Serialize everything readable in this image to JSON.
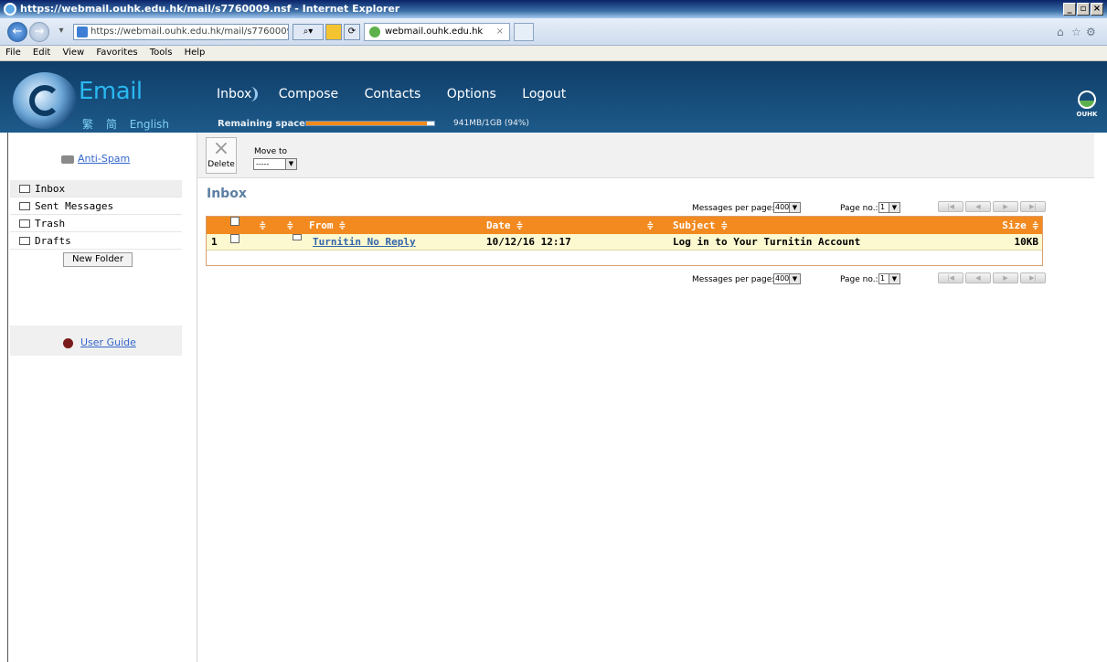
{
  "window": {
    "title": "https://webmail.ouhk.edu.hk/mail/s7760009.nsf - Internet Explorer",
    "url": "https://webmail.ouhk.edu.hk/mail/s7760009.nsf",
    "tab_title": "webmail.ouhk.edu.hk",
    "tab_close": "×"
  },
  "menu": [
    "File",
    "Edit",
    "View",
    "Favorites",
    "Tools",
    "Help"
  ],
  "header": {
    "logo_text": "Email",
    "languages": [
      "繁",
      "简",
      "English"
    ],
    "nav": [
      "Inbox",
      "Compose",
      "Contacts",
      "Options",
      "Logout"
    ],
    "remaining_label": "Remaining space",
    "quota_fraction": 0.94,
    "quota_text": "941MB/1GB (94%)",
    "brand": "OUHK"
  },
  "sidebar": {
    "anti_spam": "Anti-Spam",
    "folders": [
      "Inbox",
      "Sent Messages",
      "Trash",
      "Drafts"
    ],
    "new_folder": "New Folder",
    "user_guide": "User Guide"
  },
  "toolbar": {
    "delete_label": "Delete",
    "delete_glyph": "×",
    "move_to_label": "Move to",
    "move_to_value": "-----"
  },
  "inbox": {
    "title": "Inbox",
    "messages_per_page_label": "Messages per page:",
    "messages_per_page_value": "400",
    "page_no_label": "Page no.:",
    "page_no_value": "1",
    "columns": {
      "sort": "≑",
      "from": "From ≑",
      "date": "Date ≑",
      "subject": "Subject ≑",
      "size": "Size ≑"
    },
    "rows": [
      {
        "index": "1",
        "from": "Turnitin No Reply",
        "date": "10/12/16 12:17",
        "subject": "Log in to Your Turnitin Account",
        "size": "10KB"
      }
    ]
  },
  "colors": {
    "header_bg": "#1d5a8a",
    "table_header": "#f28a20",
    "row_bg": "#fcf8cf",
    "link": "#3366cc"
  }
}
